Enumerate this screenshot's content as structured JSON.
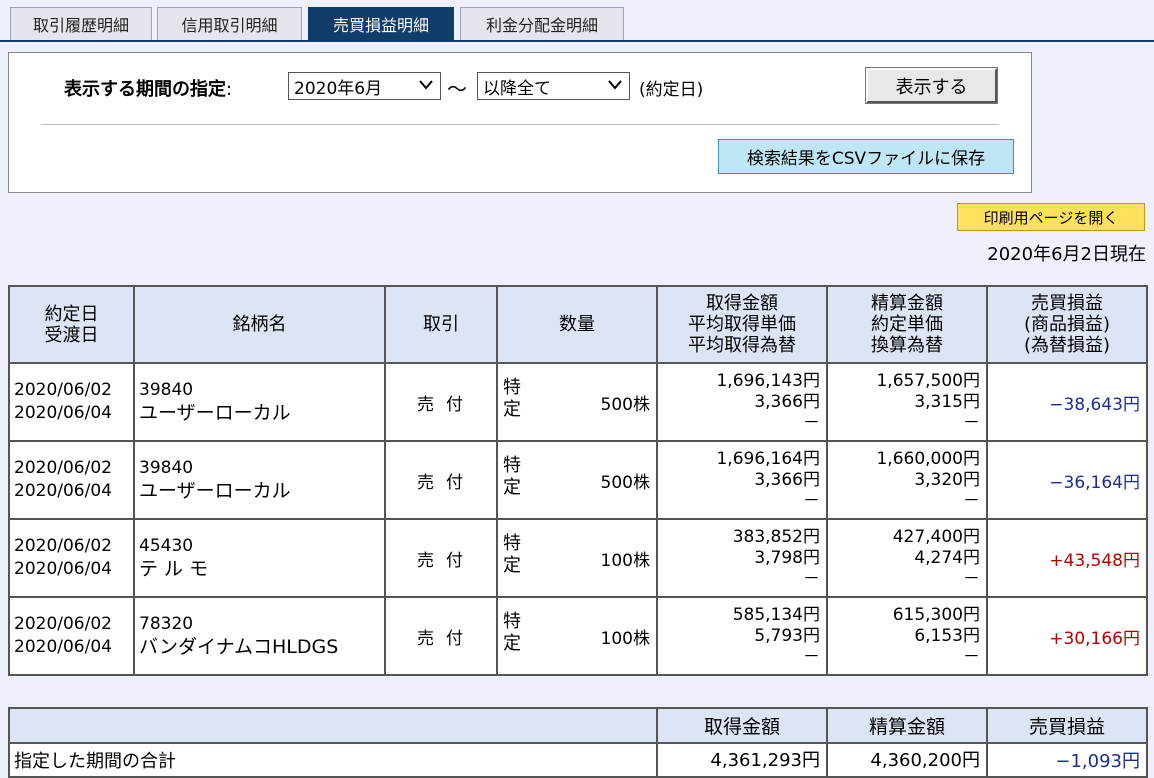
{
  "tabs": [
    {
      "label": "取引履歴明細",
      "active": false
    },
    {
      "label": "信用取引明細",
      "active": false
    },
    {
      "label": "売買損益明細",
      "active": true
    },
    {
      "label": "利金分配金明細",
      "active": false
    }
  ],
  "filter": {
    "label": "表示する期間の指定",
    "colon": ":",
    "from": "2020年6月",
    "tilde": "～",
    "to": "以降全て",
    "date_basis": "(約定日)",
    "show_button": "表示する",
    "csv_button": "検索結果をCSVファイルに保存"
  },
  "print_button": "印刷用ページを開く",
  "as_of": "2020年6月2日現在",
  "icons": {
    "dropdown": "chevron-down-icon"
  },
  "colors": {
    "tab_active": "#123d6a",
    "loss": "#1a2f8f",
    "gain": "#b80000",
    "header_bg": "#dde4f6"
  },
  "table": {
    "headers": {
      "date": [
        "約定日",
        "受渡日"
      ],
      "name": "銘柄名",
      "trade": "取引",
      "qty": "数量",
      "acq": [
        "取得金額",
        "平均取得単価",
        "平均取得為替"
      ],
      "settle": [
        "精算金額",
        "約定単価",
        "換算為替"
      ],
      "pl": [
        "売買損益",
        "(商品損益)",
        "(為替損益)"
      ]
    },
    "rows": [
      {
        "trade_date": "2020/06/02",
        "settle_date": "2020/06/04",
        "code": "39840",
        "name": "ユーザーローカル",
        "trade": "売付",
        "acct": [
          "特",
          "定"
        ],
        "qty": "500株",
        "acq_amt": "1,696,143円",
        "acq_price": "3,366円",
        "acq_fx": "－",
        "set_amt": "1,657,500円",
        "set_price": "3,315円",
        "set_fx": "－",
        "pl": "−38,643円",
        "pl_sign": "neg"
      },
      {
        "trade_date": "2020/06/02",
        "settle_date": "2020/06/04",
        "code": "39840",
        "name": "ユーザーローカル",
        "trade": "売付",
        "acct": [
          "特",
          "定"
        ],
        "qty": "500株",
        "acq_amt": "1,696,164円",
        "acq_price": "3,366円",
        "acq_fx": "－",
        "set_amt": "1,660,000円",
        "set_price": "3,320円",
        "set_fx": "－",
        "pl": "−36,164円",
        "pl_sign": "neg"
      },
      {
        "trade_date": "2020/06/02",
        "settle_date": "2020/06/04",
        "code": "45430",
        "name": "テ ル モ",
        "trade": "売付",
        "acct": [
          "特",
          "定"
        ],
        "qty": "100株",
        "acq_amt": "383,852円",
        "acq_price": "3,798円",
        "acq_fx": "－",
        "set_amt": "427,400円",
        "set_price": "4,274円",
        "set_fx": "－",
        "pl": "+43,548円",
        "pl_sign": "pos"
      },
      {
        "trade_date": "2020/06/02",
        "settle_date": "2020/06/04",
        "code": "78320",
        "name": "バンダイナムコHLDGS",
        "trade": "売付",
        "acct": [
          "特",
          "定"
        ],
        "qty": "100株",
        "acq_amt": "585,134円",
        "acq_price": "5,793円",
        "acq_fx": "－",
        "set_amt": "615,300円",
        "set_price": "6,153円",
        "set_fx": "－",
        "pl": "+30,166円",
        "pl_sign": "pos"
      }
    ]
  },
  "summary": {
    "headers": {
      "acq": "取得金額",
      "settle": "精算金額",
      "pl": "売買損益"
    },
    "label": "指定した期間の合計",
    "acq": "4,361,293円",
    "settle": "4,360,200円",
    "pl": "−1,093円"
  }
}
